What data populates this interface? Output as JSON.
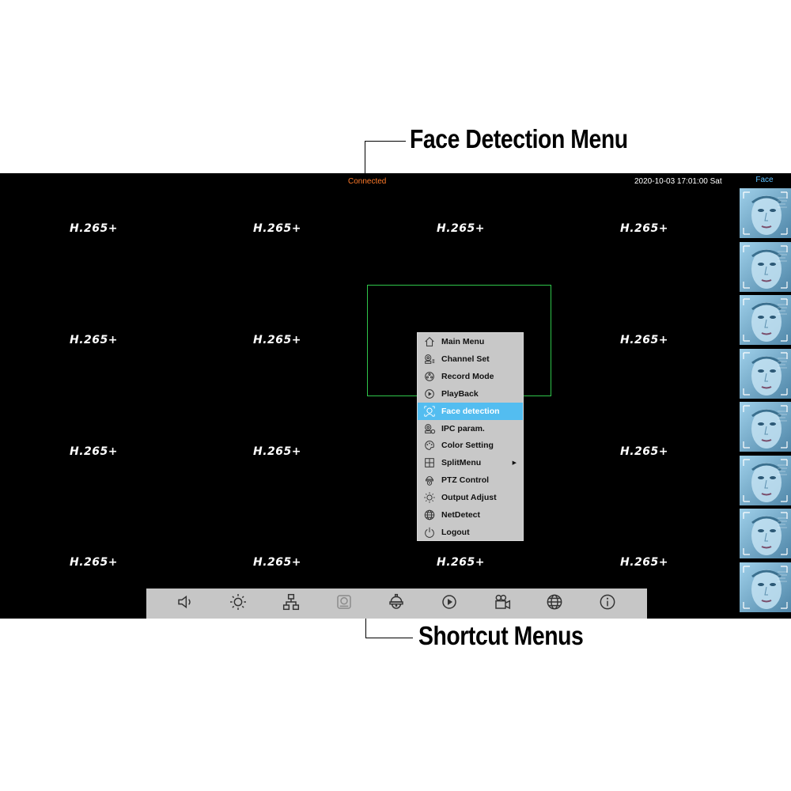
{
  "callouts": {
    "face_detection_menu": "Face Detection Menu",
    "shortcut_menus": "Shortcut Menus"
  },
  "status_bar": {
    "connection": "Connected",
    "datetime": "2020-10-03 17:01:00 Sat",
    "connection_color": "#ff7a29"
  },
  "face_panel": {
    "title": "Face",
    "thumbnail_count": 8
  },
  "channel_grid": {
    "codec_label": "H.265+",
    "rows": [
      [
        "H.265+",
        "H.265+",
        "H.265+",
        "H.265+"
      ],
      [
        "H.265+",
        "H.265+",
        "",
        "H.265+"
      ],
      [
        "H.265+",
        "H.265+",
        "",
        "H.265+"
      ],
      [
        "H.265+",
        "H.265+",
        "H.265+",
        "H.265+"
      ]
    ]
  },
  "context_menu": {
    "items": [
      {
        "label": "Main Menu",
        "icon": "home-icon"
      },
      {
        "label": "Channel Set",
        "icon": "channel-set-icon"
      },
      {
        "label": "Record Mode",
        "icon": "record-mode-icon"
      },
      {
        "label": "PlayBack",
        "icon": "playback-icon"
      },
      {
        "label": "Face detection",
        "icon": "face-detection-icon",
        "active": true
      },
      {
        "label": "IPC param.",
        "icon": "ipc-param-icon"
      },
      {
        "label": "Color Setting",
        "icon": "palette-icon"
      },
      {
        "label": "SplitMenu",
        "icon": "split-grid-icon",
        "submenu": true
      },
      {
        "label": "PTZ Control",
        "icon": "ptz-camera-icon"
      },
      {
        "label": "Output Adjust",
        "icon": "brightness-icon"
      },
      {
        "label": "NetDetect",
        "icon": "globe-icon"
      },
      {
        "label": "Logout",
        "icon": "power-icon"
      }
    ],
    "active_color": "#53bdf0"
  },
  "toolbar": {
    "buttons": [
      {
        "icon": "volume-icon"
      },
      {
        "icon": "brightness-icon"
      },
      {
        "icon": "network-icon"
      },
      {
        "icon": "hard-disk-icon"
      },
      {
        "icon": "ptz-dome-icon"
      },
      {
        "icon": "playback-icon"
      },
      {
        "icon": "video-camera-icon"
      },
      {
        "icon": "globe-icon"
      },
      {
        "icon": "info-icon"
      }
    ]
  }
}
